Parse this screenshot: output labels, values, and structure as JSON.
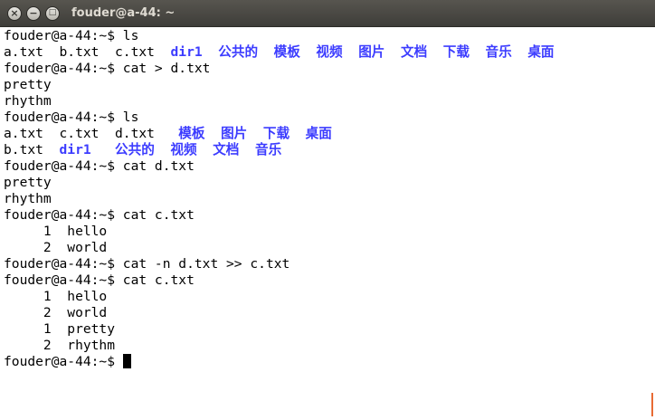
{
  "window": {
    "title": "fouder@a-44: ~"
  },
  "controls": {
    "close": "×",
    "minimize": "−",
    "maximize": "□"
  },
  "terminal": {
    "lines": [
      [
        {
          "t": "fouder@a-44:~$ ls"
        }
      ],
      [
        {
          "t": "a.txt  b.txt  c.txt  "
        },
        {
          "t": "dir1",
          "dir": true
        },
        {
          "t": "  "
        },
        {
          "t": "公共的",
          "dir": true
        },
        {
          "t": "  "
        },
        {
          "t": "模板",
          "dir": true
        },
        {
          "t": "  "
        },
        {
          "t": "视频",
          "dir": true
        },
        {
          "t": "  "
        },
        {
          "t": "图片",
          "dir": true
        },
        {
          "t": "  "
        },
        {
          "t": "文档",
          "dir": true
        },
        {
          "t": "  "
        },
        {
          "t": "下载",
          "dir": true
        },
        {
          "t": "  "
        },
        {
          "t": "音乐",
          "dir": true
        },
        {
          "t": "  "
        },
        {
          "t": "桌面",
          "dir": true
        }
      ],
      [
        {
          "t": "fouder@a-44:~$ cat > d.txt"
        }
      ],
      [
        {
          "t": "pretty"
        }
      ],
      [
        {
          "t": "rhythm"
        }
      ],
      [
        {
          "t": "fouder@a-44:~$ ls"
        }
      ],
      [
        {
          "t": "a.txt  c.txt  d.txt   "
        },
        {
          "t": "模板",
          "dir": true
        },
        {
          "t": "  "
        },
        {
          "t": "图片",
          "dir": true
        },
        {
          "t": "  "
        },
        {
          "t": "下载",
          "dir": true
        },
        {
          "t": "  "
        },
        {
          "t": "桌面",
          "dir": true
        }
      ],
      [
        {
          "t": "b.txt  "
        },
        {
          "t": "dir1",
          "dir": true
        },
        {
          "t": "   "
        },
        {
          "t": "公共的",
          "dir": true
        },
        {
          "t": "  "
        },
        {
          "t": "视频",
          "dir": true
        },
        {
          "t": "  "
        },
        {
          "t": "文档",
          "dir": true
        },
        {
          "t": "  "
        },
        {
          "t": "音乐",
          "dir": true
        }
      ],
      [
        {
          "t": "fouder@a-44:~$ cat d.txt"
        }
      ],
      [
        {
          "t": "pretty"
        }
      ],
      [
        {
          "t": "rhythm"
        }
      ],
      [
        {
          "t": "fouder@a-44:~$ cat c.txt"
        }
      ],
      [
        {
          "t": "     1  hello"
        }
      ],
      [
        {
          "t": "     2  world"
        }
      ],
      [
        {
          "t": "fouder@a-44:~$ cat -n d.txt >> c.txt"
        }
      ],
      [
        {
          "t": "fouder@a-44:~$ cat c.txt"
        }
      ],
      [
        {
          "t": "     1  hello"
        }
      ],
      [
        {
          "t": "     2  world"
        }
      ],
      [
        {
          "t": "     1  pretty"
        }
      ],
      [
        {
          "t": "     2  rhythm"
        }
      ],
      [
        {
          "t": "fouder@a-44:~$ "
        }
      ]
    ]
  }
}
